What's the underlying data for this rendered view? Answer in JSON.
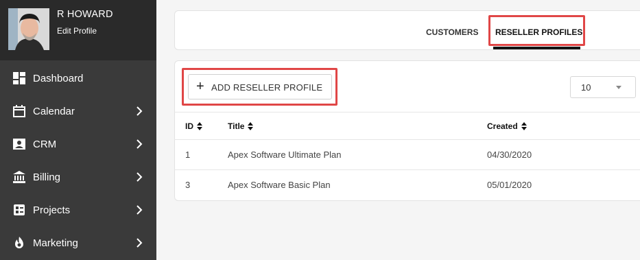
{
  "profile": {
    "name": "R HOWARD",
    "edit_label": "Edit Profile"
  },
  "sidebar": {
    "items": [
      {
        "label": "Dashboard",
        "icon": "dashboard-icon",
        "has_chevron": false
      },
      {
        "label": "Calendar",
        "icon": "calendar-icon",
        "has_chevron": true
      },
      {
        "label": "CRM",
        "icon": "contact-card-icon",
        "has_chevron": true
      },
      {
        "label": "Billing",
        "icon": "bank-icon",
        "has_chevron": true
      },
      {
        "label": "Projects",
        "icon": "projects-icon",
        "has_chevron": true
      },
      {
        "label": "Marketing",
        "icon": "flame-icon",
        "has_chevron": true
      }
    ]
  },
  "tabs": {
    "customers": "CUSTOMERS",
    "reseller_profiles": "RESELLER PROFILES"
  },
  "toolbar": {
    "add_label": "ADD RESELLER PROFILE",
    "page_size": "10"
  },
  "table": {
    "headers": {
      "id": "ID",
      "title": "Title",
      "created": "Created"
    },
    "rows": [
      {
        "id": "1",
        "title": "Apex Software Ultimate Plan",
        "created": "04/30/2020"
      },
      {
        "id": "3",
        "title": "Apex Software Basic Plan",
        "created": "05/01/2020"
      }
    ]
  },
  "colors": {
    "sidebar": "#3a3a3a",
    "profile_bg": "#2a2a2a",
    "highlight": "#e04646"
  }
}
